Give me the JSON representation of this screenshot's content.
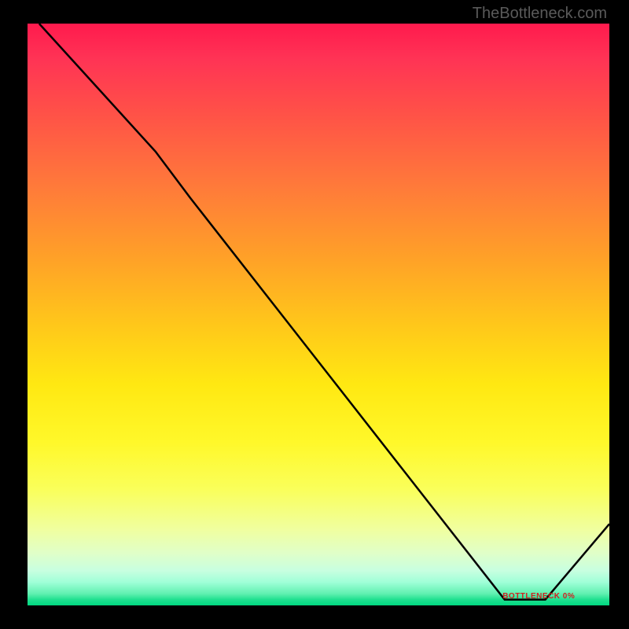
{
  "watermark": "TheBottleneck.com",
  "chart_data": {
    "type": "line",
    "title": "",
    "xlabel": "",
    "ylabel": "",
    "xlim": [
      0,
      100
    ],
    "ylim": [
      0,
      100
    ],
    "background_gradient": "red-to-green vertical",
    "series": [
      {
        "name": "curve",
        "points": [
          {
            "x": 2,
            "y": 100
          },
          {
            "x": 22,
            "y": 78
          },
          {
            "x": 28,
            "y": 70
          },
          {
            "x": 82,
            "y": 1
          },
          {
            "x": 89,
            "y": 1
          },
          {
            "x": 100,
            "y": 14
          }
        ]
      }
    ],
    "bottom_marker_label": "BOTTLENECK 0%"
  }
}
